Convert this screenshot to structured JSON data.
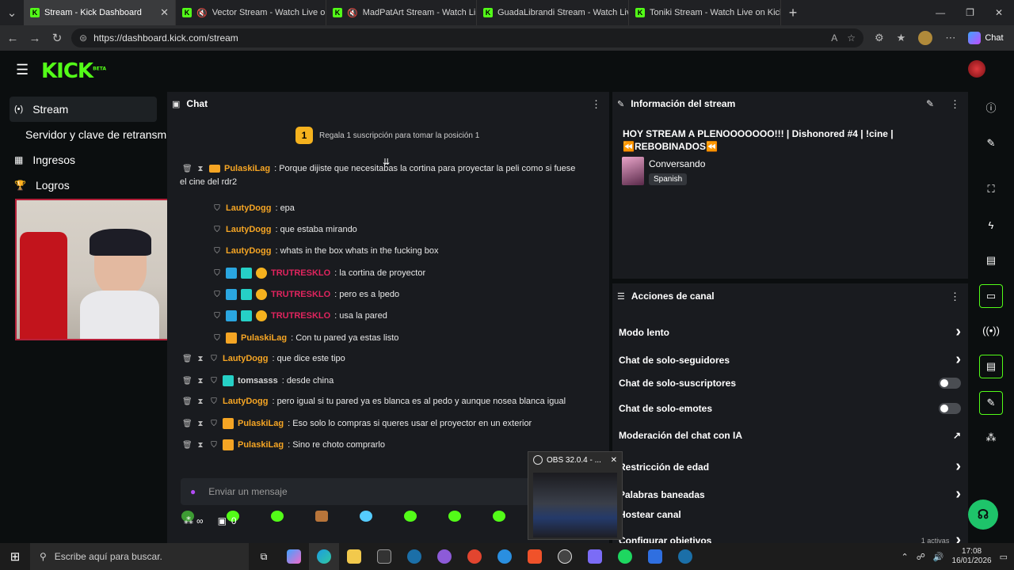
{
  "browser": {
    "tabs": [
      {
        "title": "Stream - Kick Dashboard",
        "active": true
      },
      {
        "title": "Vector Stream - Watch Live on",
        "active": false
      },
      {
        "title": "MadPatArt Stream - Watch Li",
        "active": false
      },
      {
        "title": "GuadaLibrandi Stream - Watch Liv",
        "active": false
      },
      {
        "title": "Toniki Stream - Watch Live on Kick",
        "active": false
      }
    ],
    "url": "https://dashboard.kick.com/stream",
    "chat_button": "Chat"
  },
  "brand": {
    "logo": "KICK",
    "beta": "BETA",
    "accent": "#53fc18"
  },
  "sidebar": {
    "items": [
      {
        "label": "Stream",
        "icon": "broadcast-icon",
        "active": true
      },
      {
        "label": "Servidor y clave de retransmisión",
        "icon": "",
        "active": false
      },
      {
        "label": "Ingresos",
        "icon": "chart-icon",
        "active": false
      },
      {
        "label": "Logros",
        "icon": "trophy-icon",
        "active": false
      }
    ]
  },
  "chat": {
    "title": "Chat",
    "gift_rank": "1",
    "gift_text": "Regala 1 suscripción para tomar la posición 1",
    "partial_line_user": "PulaskiLag",
    "partial_line_text": ": Porque dijiste que necesitabas la cortina para proyectar la peli como si fuese",
    "partial_line_cont": "el cine del rdr2",
    "messages": [
      {
        "user": "LautyDogg",
        "text": ": epa",
        "color": "#f5a524"
      },
      {
        "user": "LautyDogg",
        "text": ": que estaba mirando",
        "color": "#f5a524"
      },
      {
        "user": "LautyDogg",
        "text": ": whats in the box whats in the fucking box",
        "color": "#f5a524"
      },
      {
        "user": "TRUTRESKLO",
        "text": ": la cortina de proyector",
        "color": "#e0245e"
      },
      {
        "user": "TRUTRESKLO",
        "text": ": pero es a lpedo",
        "color": "#e0245e"
      },
      {
        "user": "TRUTRESKLO",
        "text": ": usa la pared",
        "color": "#e0245e"
      },
      {
        "user": "PulaskiLag",
        "text": ": Con tu pared ya estas listo",
        "color": "#f5a524"
      },
      {
        "user": "LautyDogg",
        "text": ": que dice este tipo",
        "color": "#f5a524"
      },
      {
        "user": "tomsasss",
        "text": ": desde china",
        "color": "#d6d6d6"
      },
      {
        "user": "LautyDogg",
        "text": ": pero igual si tu pared ya es blanca es al pedo y aunque nosea blanca igual",
        "color": "#f5a524"
      },
      {
        "user": "PulaskiLag",
        "text": ": Eso solo lo compras si queres usar el proyector en un exterior",
        "color": "#f5a524"
      },
      {
        "user": "PulaskiLag",
        "text": ": Sino re choto comprarlo",
        "color": "#f5a524"
      }
    ],
    "input_placeholder": "Enviar un mensaje",
    "viewers_icon": "∞",
    "points": "0"
  },
  "stream_info": {
    "title": "Información del stream",
    "stream_title": "HOY STREAM A PLENOOOOOOO!!! | Dishonored #4 | !cine | ⏪REBOBINADOS⏪",
    "category": "Conversando",
    "language": "Spanish"
  },
  "channel_actions": {
    "title": "Acciones de canal",
    "items": [
      {
        "label": "Modo lento",
        "control": "chevron"
      },
      {
        "label": "Chat de solo-seguidores",
        "control": "chevron"
      },
      {
        "label": "Chat de solo-suscriptores",
        "control": "toggle"
      },
      {
        "label": "Chat de solo-emotes",
        "control": "toggle"
      },
      {
        "label": "Moderación del chat con IA",
        "control": "external"
      },
      {
        "label": "Restricción de edad",
        "control": "chevron"
      },
      {
        "label": "Palabras baneadas",
        "control": "chevron"
      },
      {
        "label": "Hostear canal",
        "control": "none"
      },
      {
        "label": "Configurar objetivos",
        "control": "chevron"
      }
    ],
    "goal_status": "1 activas"
  },
  "obs_popup": {
    "label": "OBS 32.0.4 - ..."
  },
  "taskbar": {
    "search_placeholder": "Escribe aquí para buscar.",
    "time": "17:08",
    "date": "16/01/2026"
  }
}
